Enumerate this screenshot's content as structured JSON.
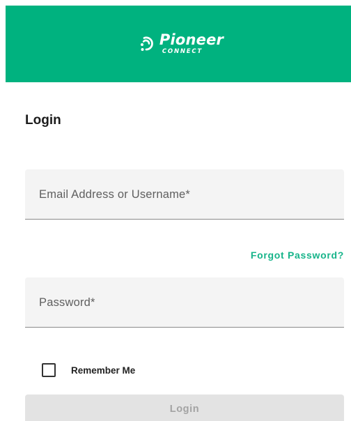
{
  "brand": {
    "name": "Pioneer",
    "subtitle": "CONNECT",
    "color": "#00b27f",
    "logo_icon": "pioneer-logo-icon"
  },
  "form": {
    "title": "Login",
    "email_label": "Email Address or Username*",
    "password_label": "Password*",
    "forgot_password": "Forgot Password?",
    "remember_me": "Remember Me",
    "remember_checked": false,
    "submit_label": "Login"
  },
  "colors": {
    "accent": "#17b48a",
    "field_bg": "#f4f4f4",
    "button_disabled_bg": "#e3e3e3"
  }
}
